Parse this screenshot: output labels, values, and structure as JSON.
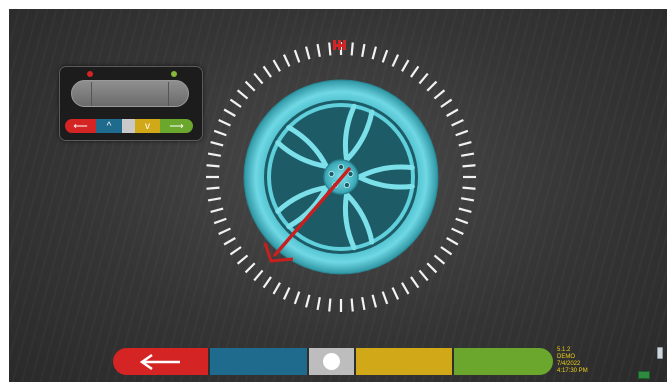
{
  "colors": {
    "wheel": "#5fd0dc",
    "accent_red": "#d42424",
    "blue": "#1f6b8e",
    "yellow": "#d1a818",
    "green": "#6aa72c"
  },
  "indicator": {
    "left_dot": "red",
    "right_dot": "green",
    "buttons": [
      {
        "name": "back-arrow-icon",
        "glyph": "⟵"
      },
      {
        "name": "chevron-up-icon",
        "glyph": "^"
      },
      {
        "name": "blank-button",
        "glyph": ""
      },
      {
        "name": "chevron-down-icon",
        "glyph": "v"
      },
      {
        "name": "forward-arrow-icon",
        "glyph": "⟶"
      }
    ]
  },
  "bottom_bar": {
    "buttons": [
      "back-button",
      "blue-button",
      "center-button",
      "yellow-button",
      "green-button"
    ]
  },
  "status": {
    "version": "5.1.2",
    "mode": "DEMO",
    "date": "7/4/2022",
    "time": "4:17:30 PM"
  }
}
